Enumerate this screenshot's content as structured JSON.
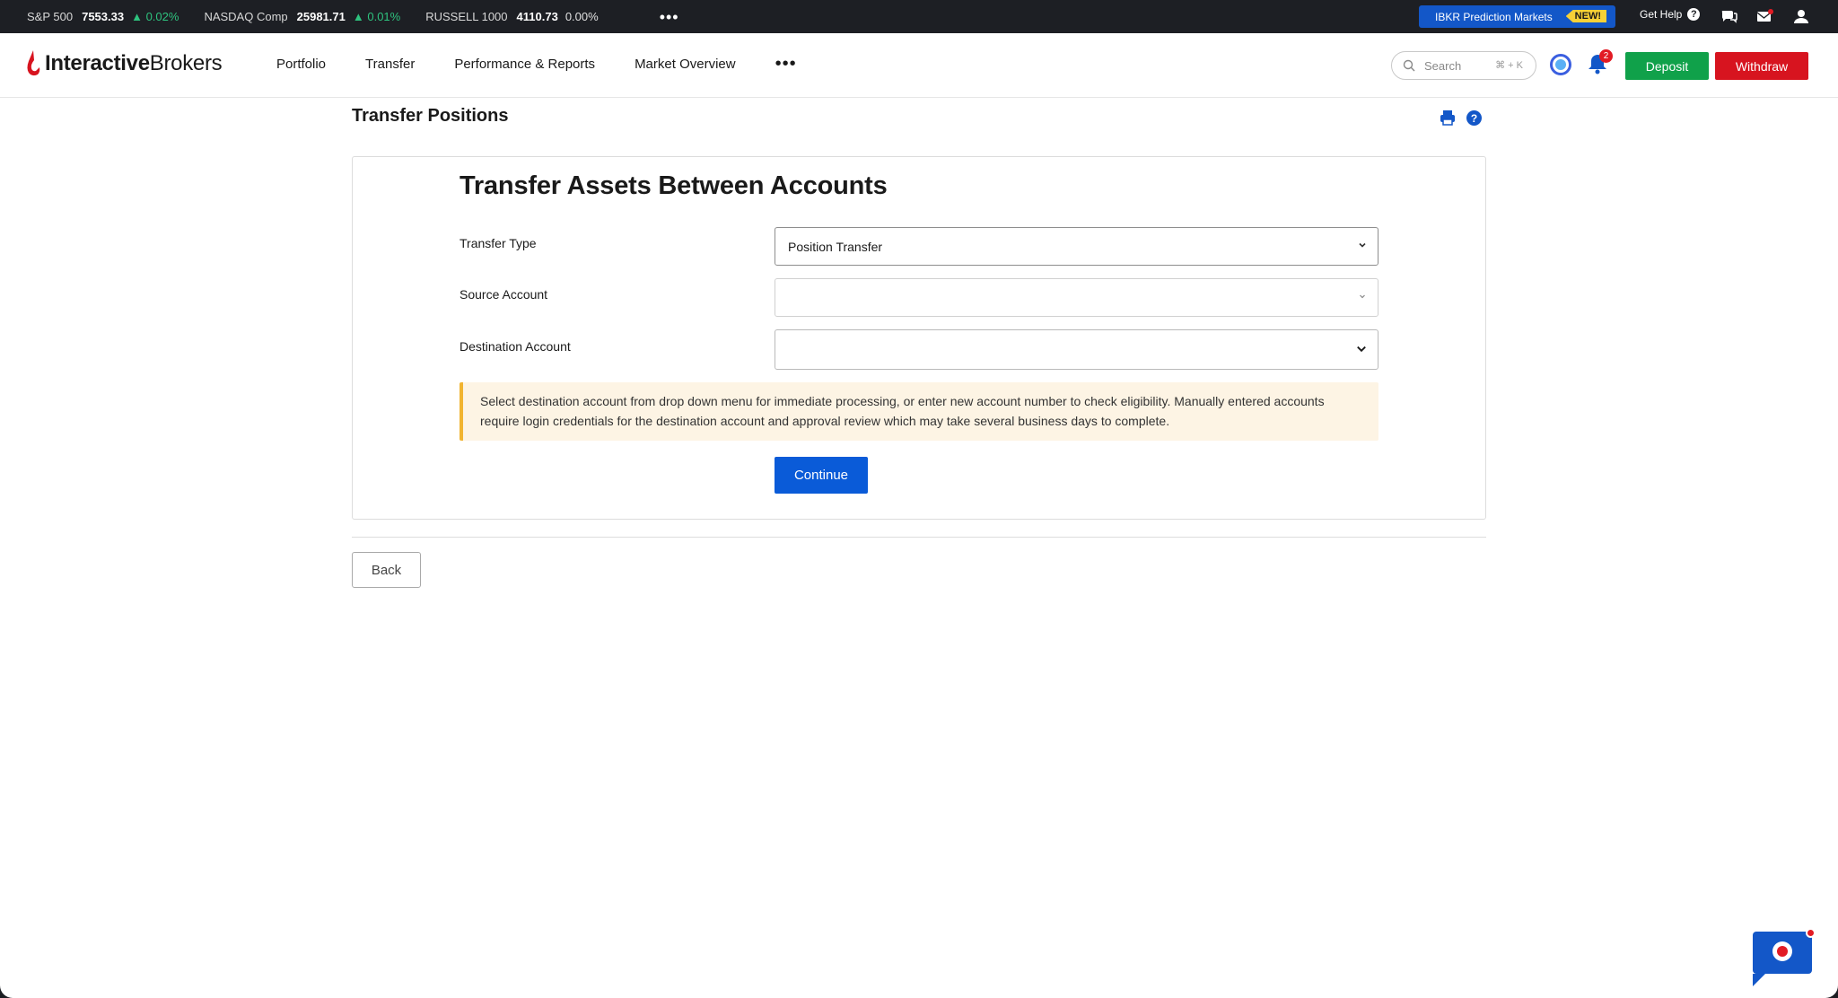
{
  "ticker": {
    "items": [
      {
        "name": "S&P 500",
        "value": "7553.33",
        "change": "▲ 0.02%",
        "direction": "up"
      },
      {
        "name": "NASDAQ Comp",
        "value": "25981.71",
        "change": "▲ 0.01%",
        "direction": "up"
      },
      {
        "name": "RUSSELL 1000",
        "value": "4110.73",
        "change": "0.00%",
        "direction": "flat"
      }
    ],
    "more": "•••",
    "promo_label": "IBKR Prediction Markets",
    "promo_badge": "NEW!",
    "help_label": "Get Help"
  },
  "header": {
    "brand_bold": "Interactive",
    "brand_regular": "Brokers",
    "nav": [
      "Portfolio",
      "Transfer",
      "Performance & Reports",
      "Market Overview"
    ],
    "nav_more": "•••",
    "search_placeholder": "Search",
    "search_shortcut": "⌘ + K",
    "notification_count": "2",
    "deposit_label": "Deposit",
    "withdraw_label": "Withdraw"
  },
  "page": {
    "title": "Transfer Positions",
    "help_glyph": "?"
  },
  "form": {
    "title": "Transfer Assets Between Accounts",
    "transfer_type_label": "Transfer Type",
    "transfer_type_value": "Position Transfer",
    "source_label": "Source Account",
    "source_value": "",
    "destination_label": "Destination Account",
    "destination_value": "",
    "notice_text": "Select destination account from drop down menu for immediate processing, or enter new account number to check eligibility. Manually entered accounts require login credentials for the destination account and approval review which may take several business days to complete.",
    "continue_label": "Continue"
  },
  "footer": {
    "back_label": "Back"
  },
  "colors": {
    "accent_blue": "#0a5bd8",
    "deposit_green": "#10a14a",
    "withdraw_red": "#d7141f",
    "notice_bg": "#fdf4e4",
    "notice_border": "#f1b430",
    "up_green": "#2ec27e"
  }
}
